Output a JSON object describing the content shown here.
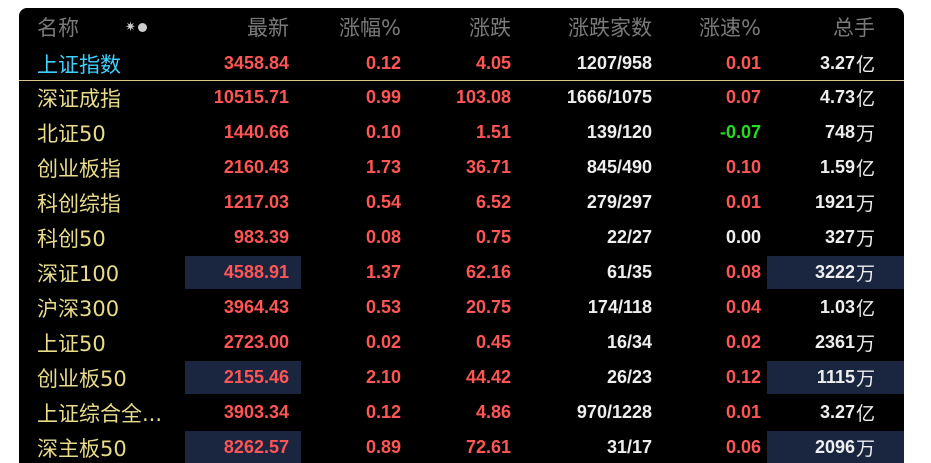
{
  "header": {
    "name": "名称",
    "latest": "最新",
    "pct": "涨幅%",
    "chg": "涨跌",
    "breadth": "涨跌家数",
    "speed": "涨速%",
    "volume": "总手"
  },
  "sort_icon": "sort-toggle-icon",
  "colors": {
    "up": "#ff5555",
    "down": "#22dd22",
    "name": "#e8dc8a",
    "selected": "#3fd0ff",
    "highlight": "#1a2540"
  },
  "rows": [
    {
      "name": "上证指数",
      "latest": "3458.84",
      "pct": "0.12",
      "chg": "4.05",
      "breadth": "1207/958",
      "speed": "0.01",
      "speed_dir": "up",
      "vol_num": "3.27",
      "vol_unit": "亿"
    },
    {
      "name": "深证成指",
      "latest": "10515.71",
      "pct": "0.99",
      "chg": "103.08",
      "breadth": "1666/1075",
      "speed": "0.07",
      "speed_dir": "up",
      "vol_num": "4.73",
      "vol_unit": "亿"
    },
    {
      "name": "北证50",
      "latest": "1440.66",
      "pct": "0.10",
      "chg": "1.51",
      "breadth": "139/120",
      "speed": "-0.07",
      "speed_dir": "down",
      "vol_num": "748",
      "vol_unit": "万"
    },
    {
      "name": "创业板指",
      "latest": "2160.43",
      "pct": "1.73",
      "chg": "36.71",
      "breadth": "845/490",
      "speed": "0.10",
      "speed_dir": "up",
      "vol_num": "1.59",
      "vol_unit": "亿"
    },
    {
      "name": "科创综指",
      "latest": "1217.03",
      "pct": "0.54",
      "chg": "6.52",
      "breadth": "279/297",
      "speed": "0.01",
      "speed_dir": "up",
      "vol_num": "1921",
      "vol_unit": "万"
    },
    {
      "name": "科创50",
      "latest": "983.39",
      "pct": "0.08",
      "chg": "0.75",
      "breadth": "22/27",
      "speed": "0.00",
      "speed_dir": "flat",
      "vol_num": "327",
      "vol_unit": "万"
    },
    {
      "name": "深证100",
      "latest": "4588.91",
      "pct": "1.37",
      "chg": "62.16",
      "breadth": "61/35",
      "speed": "0.08",
      "speed_dir": "up",
      "vol_num": "3222",
      "vol_unit": "万"
    },
    {
      "name": "沪深300",
      "latest": "3964.43",
      "pct": "0.53",
      "chg": "20.75",
      "breadth": "174/118",
      "speed": "0.04",
      "speed_dir": "up",
      "vol_num": "1.03",
      "vol_unit": "亿"
    },
    {
      "name": "上证50",
      "latest": "2723.00",
      "pct": "0.02",
      "chg": "0.45",
      "breadth": "16/34",
      "speed": "0.02",
      "speed_dir": "up",
      "vol_num": "2361",
      "vol_unit": "万"
    },
    {
      "name": "创业板50",
      "latest": "2155.46",
      "pct": "2.10",
      "chg": "44.42",
      "breadth": "26/23",
      "speed": "0.12",
      "speed_dir": "up",
      "vol_num": "1115",
      "vol_unit": "万"
    },
    {
      "name": "上证综合全...",
      "latest": "3903.34",
      "pct": "0.12",
      "chg": "4.86",
      "breadth": "970/1228",
      "speed": "0.01",
      "speed_dir": "up",
      "vol_num": "3.27",
      "vol_unit": "亿"
    },
    {
      "name": "深主板50",
      "latest": "8262.57",
      "pct": "0.89",
      "chg": "72.61",
      "breadth": "31/17",
      "speed": "0.06",
      "speed_dir": "up",
      "vol_num": "2096",
      "vol_unit": "万"
    }
  ]
}
